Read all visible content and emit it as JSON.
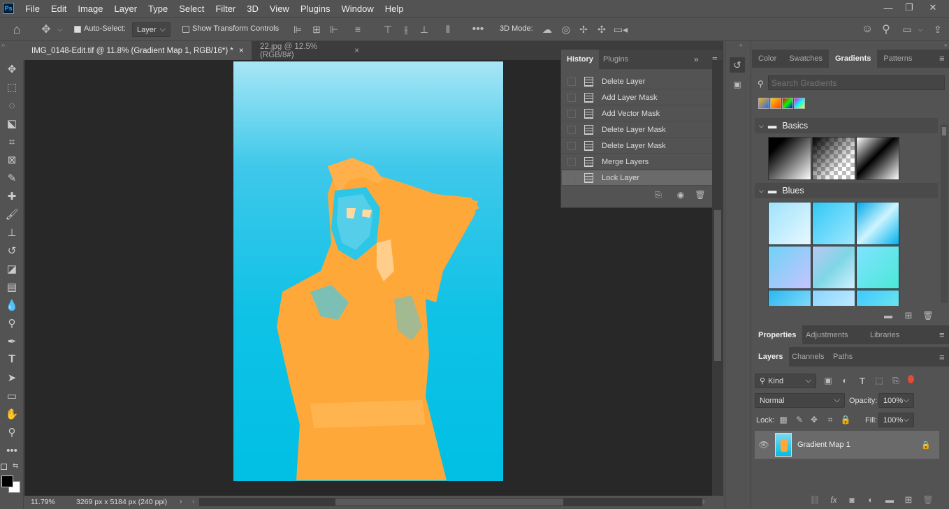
{
  "app": {
    "logo": "Ps"
  },
  "menu": [
    "File",
    "Edit",
    "Image",
    "Layer",
    "Type",
    "Select",
    "Filter",
    "3D",
    "View",
    "Plugins",
    "Window",
    "Help"
  ],
  "options": {
    "auto_select_label": "Auto-Select:",
    "layer_value": "Layer",
    "show_transform_label": "Show Transform Controls",
    "mode_3d_label": "3D Mode:"
  },
  "tabs": [
    {
      "label": "IMG_0148-Edit.tif @ 11.8% (Gradient Map 1, RGB/16*) *",
      "close": "×"
    },
    {
      "label": "22.jpg @ 12.5% (RGB/8#)",
      "close": "×"
    }
  ],
  "history_panel": {
    "tabs": [
      "History",
      "Plugins"
    ],
    "items": [
      "Delete Layer",
      "Add Layer Mask",
      "Add Vector Mask",
      "Delete Layer Mask",
      "Delete Layer Mask",
      "Merge Layers",
      "Lock Layer"
    ]
  },
  "right_top": {
    "tabs": [
      "Color",
      "Swatches",
      "Gradients",
      "Patterns"
    ],
    "search_placeholder": "Search Gradients",
    "groups": [
      {
        "name": "Basics"
      },
      {
        "name": "Blues"
      }
    ]
  },
  "properties": {
    "tabs": [
      "Properties",
      "Adjustments",
      "Libraries"
    ]
  },
  "layers": {
    "tabs": [
      "Layers",
      "Channels",
      "Paths"
    ],
    "kind_label": "Kind",
    "blend_mode": "Normal",
    "opacity_label": "Opacity:",
    "opacity_value": "100%",
    "lock_label": "Lock:",
    "fill_label": "Fill:",
    "fill_value": "100%",
    "layer_name": "Gradient Map 1"
  },
  "status": {
    "zoom": "11.79%",
    "doc_info": "3269 px x 5184 px (240 ppi)"
  },
  "colors": {
    "image_cyan": "#00c0e4",
    "image_orange": "#ffa83a",
    "ui_bg": "#535353",
    "canvas_bg": "#282828",
    "accent_red": "#e34b35"
  }
}
